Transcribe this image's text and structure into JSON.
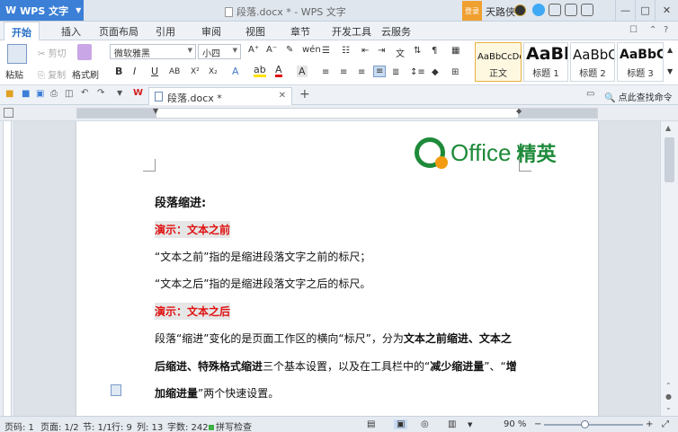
{
  "titlebar": {
    "app_name": "WPS 文字",
    "doc_title": "段落.docx * - WPS 文字",
    "login_badge": "登录",
    "user_name": "天路侠",
    "window_controls": [
      "—",
      "□",
      "✕"
    ]
  },
  "menu": {
    "tabs": [
      "开始",
      "插入",
      "页面布局",
      "引用",
      "审阅",
      "视图",
      "章节",
      "开发工具",
      "云服务"
    ]
  },
  "ribbon": {
    "paste": "粘贴",
    "cut": "剪切",
    "copy": "复制",
    "format_painter": "格式刷",
    "font_name": "微软雅黑",
    "font_size": "小四",
    "bold": "B",
    "italic": "I",
    "underline": "U",
    "styles": [
      {
        "sample": "AaBbCcDd",
        "label": "正文"
      },
      {
        "sample": "AaBb",
        "label": "标题 1"
      },
      {
        "sample": "AaBbC",
        "label": "标题 2"
      },
      {
        "sample": "AaBbC",
        "label": "标题 3"
      }
    ]
  },
  "tabbar": {
    "doc_tab": "段落.docx *",
    "find_command": "点此查找命令"
  },
  "document": {
    "logo_text": "Office",
    "logo_cn": "精英",
    "heading": "段落缩进:",
    "demo1": "演示：文本之前",
    "line1": "“文本之前”指的是缩进段落文字之前的标尺；",
    "line2": "“文本之后”指的是缩进段落文字之后的标尺。",
    "demo2": "演示：文本之后",
    "para_a_1": "段落“缩进”变化的是页面工作区的横向“标尺”，分为",
    "para_a_b": "文本之前缩进、文本之",
    "para_b_b": "后缩进、特殊格式缩进",
    "para_b_2": "三个基本设置，以及在工具栏中的“",
    "para_b_b2": "减少缩进量",
    "para_b_3": "”、“",
    "para_b_b3": "增",
    "para_c_b": "加缩进量",
    "para_c_2": "”两个快速设置。"
  },
  "status": {
    "line_no": "页码: 1",
    "pages": "页面: 1/2",
    "section": "节: 1/1",
    "row": "行: 9",
    "col": "列: 13",
    "words": "字数: 242",
    "spell": "拼写检查",
    "zoom": "90 %",
    "zoom_level": 0.45
  },
  "colors": {
    "accent": "#3b7fd6",
    "logo_green": "#1e8a3a",
    "logo_orange": "#f39c12",
    "demo_red": "#e01010"
  }
}
